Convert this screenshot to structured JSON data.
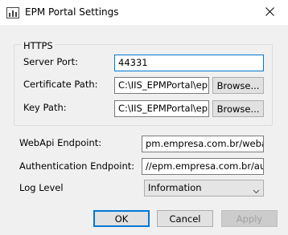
{
  "window": {
    "title": "EPM Portal Settings",
    "icon": "chart-app-icon"
  },
  "https_group": {
    "legend": "HTTPS",
    "server_port_label": "Server Port:",
    "server_port_value": "44331",
    "certificate_path_label": "Certificate Path:",
    "certificate_path_value": "C:\\IIS_EPMPortal\\epm",
    "key_path_label": "Key Path:",
    "key_path_value": "C:\\IIS_EPMPortal\\epm",
    "browse_label": "Browse..."
  },
  "settings": {
    "webapi_label": "WebApi Endpoint:",
    "webapi_value": "pm.empresa.com.br/webapi",
    "auth_label": "Authentication Endpoint:",
    "auth_value": "//epm.empresa.com.br/auth",
    "log_level_label": "Log Level",
    "log_level_value": "Information"
  },
  "buttons": {
    "ok": "OK",
    "cancel": "Cancel",
    "apply": "Apply"
  }
}
